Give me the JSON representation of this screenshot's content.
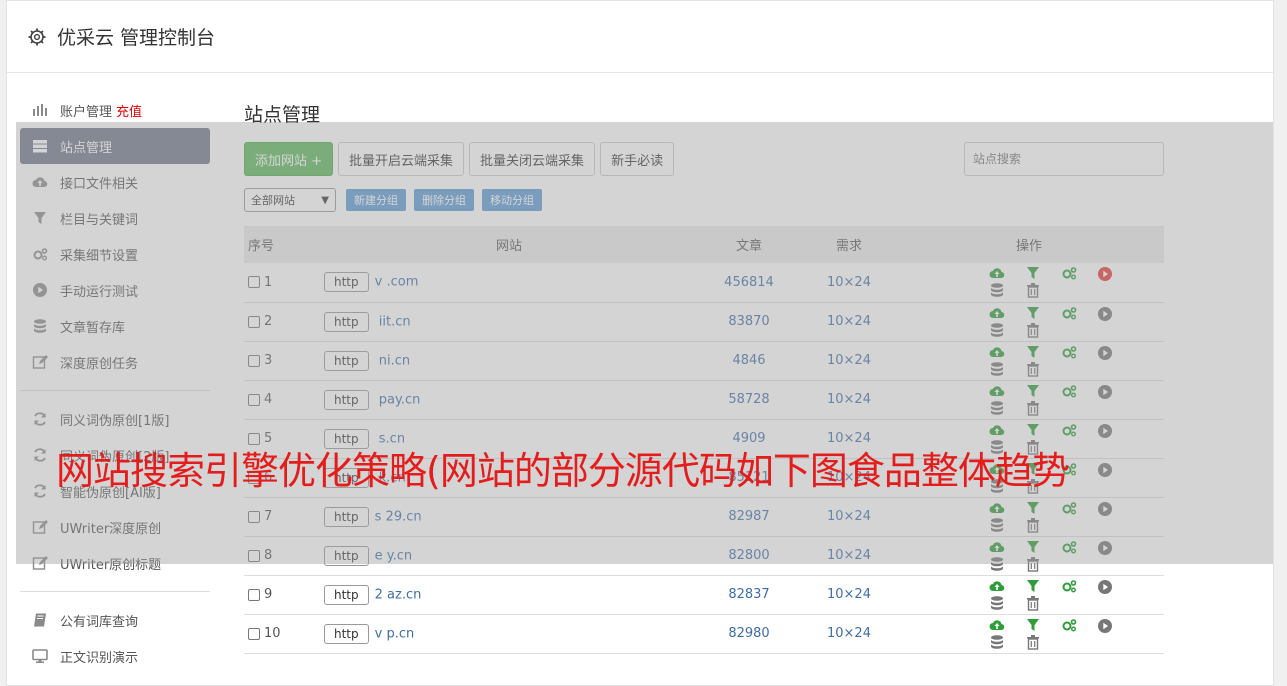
{
  "app": {
    "title": "优采云 管理控制台"
  },
  "sidebar": {
    "group1": [
      {
        "label": "账户管理",
        "extra": "充值",
        "icon": "bar-chart-icon"
      },
      {
        "label": "站点管理",
        "icon": "server-icon",
        "active": true
      },
      {
        "label": "接口文件相关",
        "icon": "cloud-upload-icon"
      },
      {
        "label": "栏目与关键词",
        "icon": "filter-icon"
      },
      {
        "label": "采集细节设置",
        "icon": "gears-icon"
      },
      {
        "label": "手动运行测试",
        "icon": "play-icon"
      },
      {
        "label": "文章暂存库",
        "icon": "database-icon"
      },
      {
        "label": "深度原创任务",
        "icon": "edit-icon"
      }
    ],
    "group2": [
      {
        "label": "同义词伪原创[1版]",
        "icon": "refresh-icon"
      },
      {
        "label": "同义词伪原创[2版]",
        "icon": "refresh-icon"
      },
      {
        "label": "智能伪原创[AI版]",
        "icon": "refresh-icon"
      },
      {
        "label": "UWriter深度原创",
        "icon": "edit-icon"
      },
      {
        "label": "UWriter原创标题",
        "icon": "edit-icon"
      }
    ],
    "group3": [
      {
        "label": "公有词库查询",
        "icon": "book-icon"
      },
      {
        "label": "正文识别演示",
        "icon": "monitor-icon"
      }
    ]
  },
  "main": {
    "title": "站点管理",
    "toolbar": {
      "add": "添加网站 +",
      "batch_on": "批量开启云端采集",
      "batch_off": "批量关闭云端采集",
      "guide": "新手必读",
      "search_placeholder": "站点搜索"
    },
    "filters": {
      "select": "全部网站",
      "new_group": "新建分组",
      "delete_group": "删除分组",
      "move_group": "移动分组"
    },
    "table": {
      "headers": [
        "序号",
        "网站",
        "文章",
        "需求",
        "操作"
      ],
      "rows": [
        {
          "no": "1",
          "proto": "http",
          "url": "v            .com",
          "articles": "456814",
          "req": "10×24",
          "running": true
        },
        {
          "no": "2",
          "proto": "http",
          "url": "       iit.cn",
          "articles": "83870",
          "req": "10×24",
          "running": false
        },
        {
          "no": "3",
          "proto": "http",
          "url": "       ni.cn",
          "articles": "4846",
          "req": "10×24",
          "running": false
        },
        {
          "no": "4",
          "proto": "http",
          "url": "       pay.cn",
          "articles": "58728",
          "req": "10×24",
          "running": false
        },
        {
          "no": "5",
          "proto": "http",
          "url": "       s.cn",
          "articles": "4909",
          "req": "10×24",
          "running": false
        },
        {
          "no": "6",
          "proto": "http",
          "url": "       k.cn",
          "articles": "85121",
          "req": "10×24",
          "running": false
        },
        {
          "no": "7",
          "proto": "http",
          "url": "s   29.cn",
          "articles": "82987",
          "req": "10×24",
          "running": false
        },
        {
          "no": "8",
          "proto": "http",
          "url": "e     y.cn",
          "articles": "82800",
          "req": "10×24",
          "running": false
        },
        {
          "no": "9",
          "proto": "http",
          "url": "2    az.cn",
          "articles": "82837",
          "req": "10×24",
          "running": false
        },
        {
          "no": "10",
          "proto": "http",
          "url": "v    p.cn",
          "articles": "82980",
          "req": "10×24",
          "running": false
        }
      ]
    }
  },
  "banner": {
    "text": "网站搜索引擎优化策略(网站的部分源代码如下图食品整体趋势"
  },
  "colors": {
    "green": "#2e9d3a",
    "red": "#e53935",
    "gray": "#777777",
    "banner": "#e51c1c"
  }
}
